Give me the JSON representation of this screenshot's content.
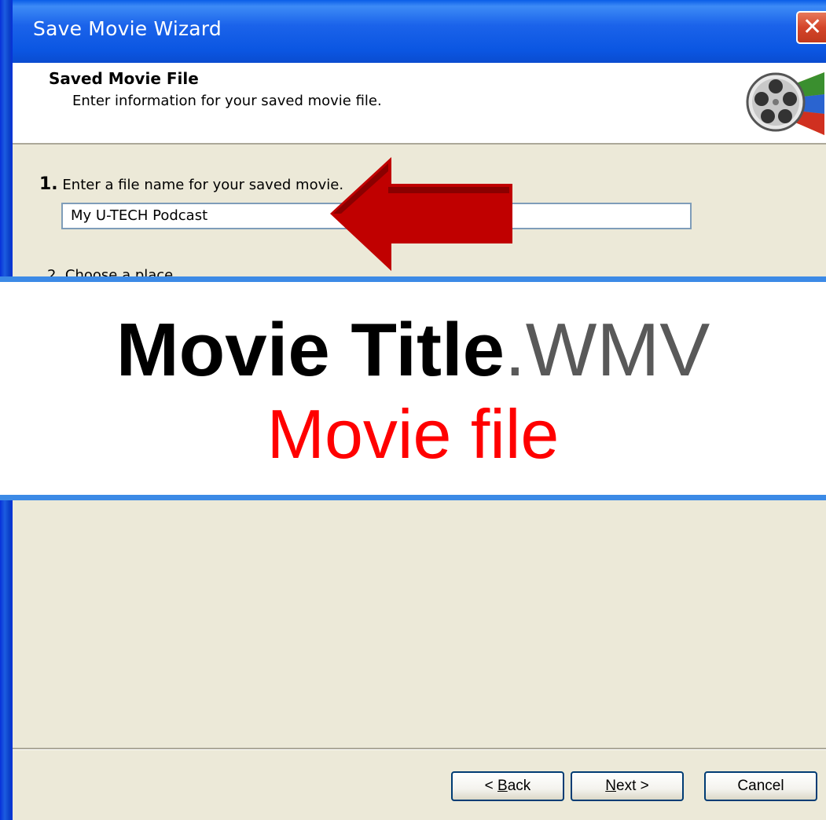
{
  "window": {
    "title": "Save Movie Wizard",
    "close_glyph": "✕"
  },
  "header": {
    "title": "Saved Movie File",
    "subtitle": "Enter information for your saved movie file.",
    "icon": "film-reel-icon"
  },
  "step1": {
    "number": "1.",
    "label": "Enter a file name for your saved movie.",
    "value": "My U-TECH Podcast"
  },
  "step2": {
    "partial_label": "2. Choose a place"
  },
  "banner": {
    "title": "Movie Title",
    "extension": ".WMV",
    "subtitle": "Movie file",
    "colors": {
      "title": "#000000",
      "extension": "#595959",
      "subtitle": "#ff0000",
      "border": "#3c8ae6"
    }
  },
  "buttons": {
    "back_prefix": "< ",
    "back_accel": "B",
    "back_rest": "ack",
    "next_accel": "N",
    "next_rest": "ext >",
    "cancel": "Cancel"
  },
  "annotation": {
    "arrow_color": "#c00000",
    "arrow_icon": "red-left-arrow-icon"
  }
}
